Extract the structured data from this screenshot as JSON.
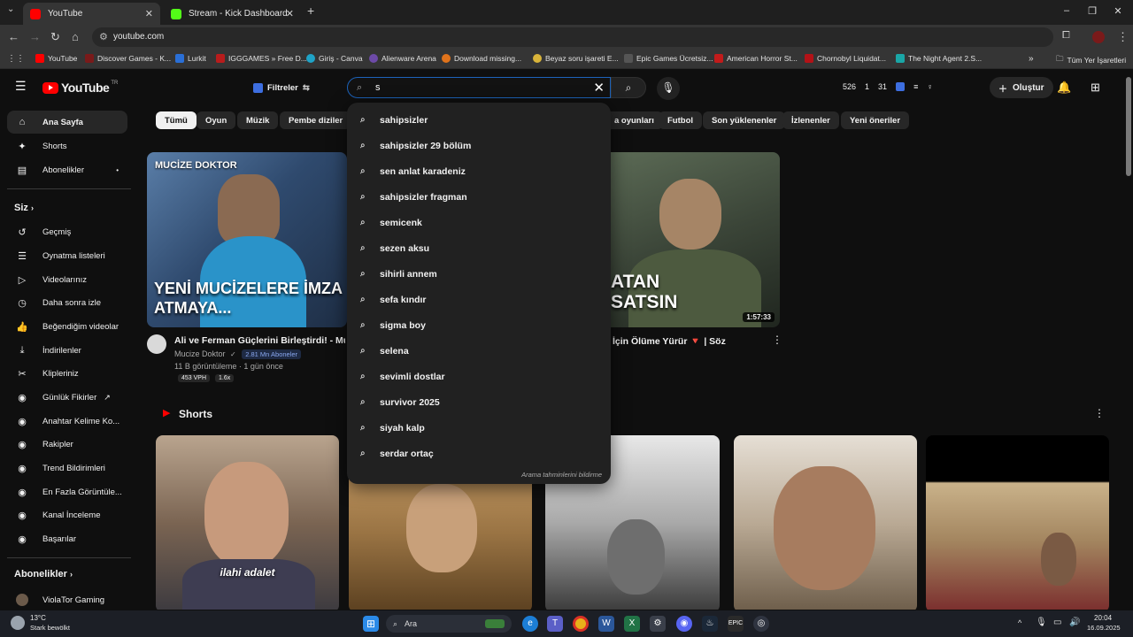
{
  "browser": {
    "tabs": [
      {
        "title": "YouTube",
        "active": true
      },
      {
        "title": "Stream - Kick Dashboard",
        "active": false
      }
    ],
    "new_tab": "+",
    "url": "youtube.com",
    "bookmarks": [
      {
        "label": "YouTube",
        "color": "#ff0000"
      },
      {
        "label": "Discover Games - K...",
        "color": "#7a1a1a"
      },
      {
        "label": "Lurkit",
        "color": "#2a6fd6"
      },
      {
        "label": "IGGGAMES » Free D...",
        "color": "#b81c1c"
      },
      {
        "label": "Giriş - Canva",
        "color": "#1fa3c7"
      },
      {
        "label": "Alienware Arena",
        "color": "#6d4aa8"
      },
      {
        "label": "Download missing...",
        "color": "#e0731b"
      },
      {
        "label": "Beyaz soru işareti E...",
        "color": "#d9b43a"
      },
      {
        "label": "Epic Games Ücretsiz...",
        "color": "#555555"
      },
      {
        "label": "American Horror St...",
        "color": "#c21b1b"
      },
      {
        "label": "Chornobyl Liquidat...",
        "color": "#b31217"
      },
      {
        "label": "The Night Agent 2.S...",
        "color": "#1aa6a6"
      }
    ],
    "bookmarks_more": "»",
    "all_bookmarks": "Tüm Yer İşaretleri"
  },
  "youtube": {
    "logo_text": "YouTube",
    "logo_region": "TR",
    "filters_label": "Filtreler",
    "search_value": "s",
    "stats": {
      "a": "526",
      "b": "1",
      "c": "31"
    },
    "create_label": "Oluştur",
    "sidebar": {
      "main": [
        {
          "label": "Ana Sayfa",
          "icon": "⌂",
          "active": true
        },
        {
          "label": "Shorts",
          "icon": "✦"
        },
        {
          "label": "Abonelikler",
          "icon": "▤",
          "dot": "•"
        }
      ],
      "you_header": "Siz",
      "you": [
        {
          "label": "Geçmiş",
          "icon": "↺"
        },
        {
          "label": "Oynatma listeleri",
          "icon": "☰"
        },
        {
          "label": "Videolarınız",
          "icon": "▷"
        },
        {
          "label": "Daha sonra izle",
          "icon": "◷"
        },
        {
          "label": "Beğendiğim videolar",
          "icon": "👍"
        },
        {
          "label": "İndirilenler",
          "icon": "⤓"
        },
        {
          "label": "Klipleriniz",
          "icon": "✂"
        },
        {
          "label": "Günlük Fikirler",
          "icon": "◉",
          "ext": "↗"
        },
        {
          "label": "Anahtar Kelime Ko...",
          "icon": "◉"
        },
        {
          "label": "Rakipler",
          "icon": "◉"
        },
        {
          "label": "Trend Bildirimleri",
          "icon": "◉"
        },
        {
          "label": "En Fazla Görüntüle...",
          "icon": "◉"
        },
        {
          "label": "Kanal İnceleme",
          "icon": "◉"
        },
        {
          "label": "Başarılar",
          "icon": "◉"
        }
      ],
      "subs_header": "Abonelikler",
      "subs": [
        {
          "label": "ViolaTor Gaming"
        }
      ]
    },
    "chips": [
      "Tümü",
      "Oyun",
      "Müzik",
      "Pembe diziler",
      "a oyunları",
      "Futbol",
      "Son yüklenenler",
      "İzlenenler",
      "Yeni öneriler"
    ],
    "videos": [
      {
        "overlay_top": "MUCİZE DOKTOR",
        "overlay_main": "YENİ MUCİZELERE İMZA ATMAYA...",
        "title": "Ali ve Ferman Güçlerini Birleştirdi! - Muci",
        "channel": "Mucize Doktor",
        "verified": "✓",
        "subs_badge": "2.81 Mn Aboneler",
        "meta": "11 B görüntüleme · 1 gün önce",
        "vph": "453 VPH",
        "ratio": "1.6x"
      },
      {
        "overlay_main": "ATAN SATSIN",
        "duration": "1:57:33",
        "title": "İçin Ölüme Yürür 🔻 | Söz"
      }
    ],
    "shorts_header": "Shorts",
    "shorts": [
      {
        "caption": "ilahi adalet"
      },
      {
        "caption": ""
      },
      {
        "caption": ""
      },
      {
        "caption": ""
      },
      {
        "caption": ""
      }
    ],
    "suggestions": [
      "sahipsizler",
      "sahipsizler 29 bölüm",
      "sen anlat karadeniz",
      "sahipsizler fragman",
      "semicenk",
      "sezen aksu",
      "sihirli annem",
      "sefa kındır",
      "sigma boy",
      "selena",
      "sevimli dostlar",
      "survivor 2025",
      "siyah kalp",
      "serdar ortaç"
    ],
    "suggest_footer": "Arama tahminlerini bildirme"
  },
  "taskbar": {
    "weather_temp": "13°C",
    "weather_desc": "Stark bewölkt",
    "search_label": "Ara",
    "time": "20:04",
    "date": "16.09.2025"
  },
  "colors": {
    "brand": "#ff0000",
    "focus": "#1c62b9"
  }
}
